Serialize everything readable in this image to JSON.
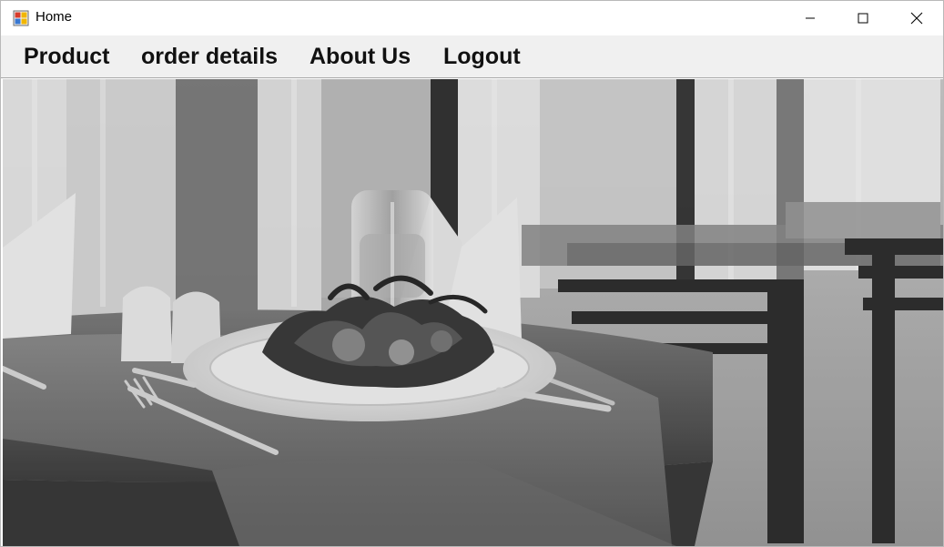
{
  "window": {
    "title": "Home",
    "icon": "app-icon",
    "controls": [
      "minimize-icon",
      "maximize-icon",
      "close-icon"
    ]
  },
  "menu": {
    "items": [
      {
        "label": "Product"
      },
      {
        "label": "order details"
      },
      {
        "label": "About Us"
      },
      {
        "label": "Logout"
      }
    ]
  },
  "content": {
    "image": "restaurant-table-photo",
    "tone": "grayscale"
  }
}
